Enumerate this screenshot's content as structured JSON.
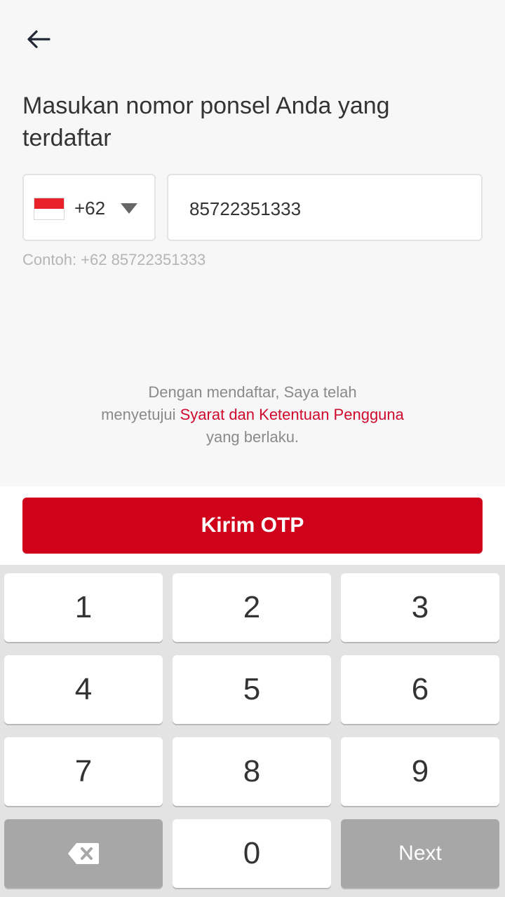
{
  "header": {
    "back_icon": "arrow-left-icon"
  },
  "title": "Masukan nomor ponsel Anda yang terdaftar",
  "country": {
    "code": "+62",
    "flag": "indonesia-flag-icon",
    "dropdown_icon": "caret-down-icon"
  },
  "phone": {
    "value": "85722351333"
  },
  "example": "Contoh: +62 85722351333",
  "terms": {
    "line1": "Dengan mendaftar, Saya telah",
    "prefix": "menyetujui ",
    "link": "Syarat dan Ketentuan Pengguna",
    "line3": "yang berlaku."
  },
  "button": {
    "label": "Kirim OTP"
  },
  "colors": {
    "accent": "#d0021b",
    "link": "#cf0a2c",
    "flag_red": "#e8212b"
  },
  "keyboard": {
    "keys": [
      "1",
      "2",
      "3",
      "4",
      "5",
      "6",
      "7",
      "8",
      "9",
      "0"
    ],
    "backspace_icon": "backspace-icon",
    "next_label": "Next"
  }
}
